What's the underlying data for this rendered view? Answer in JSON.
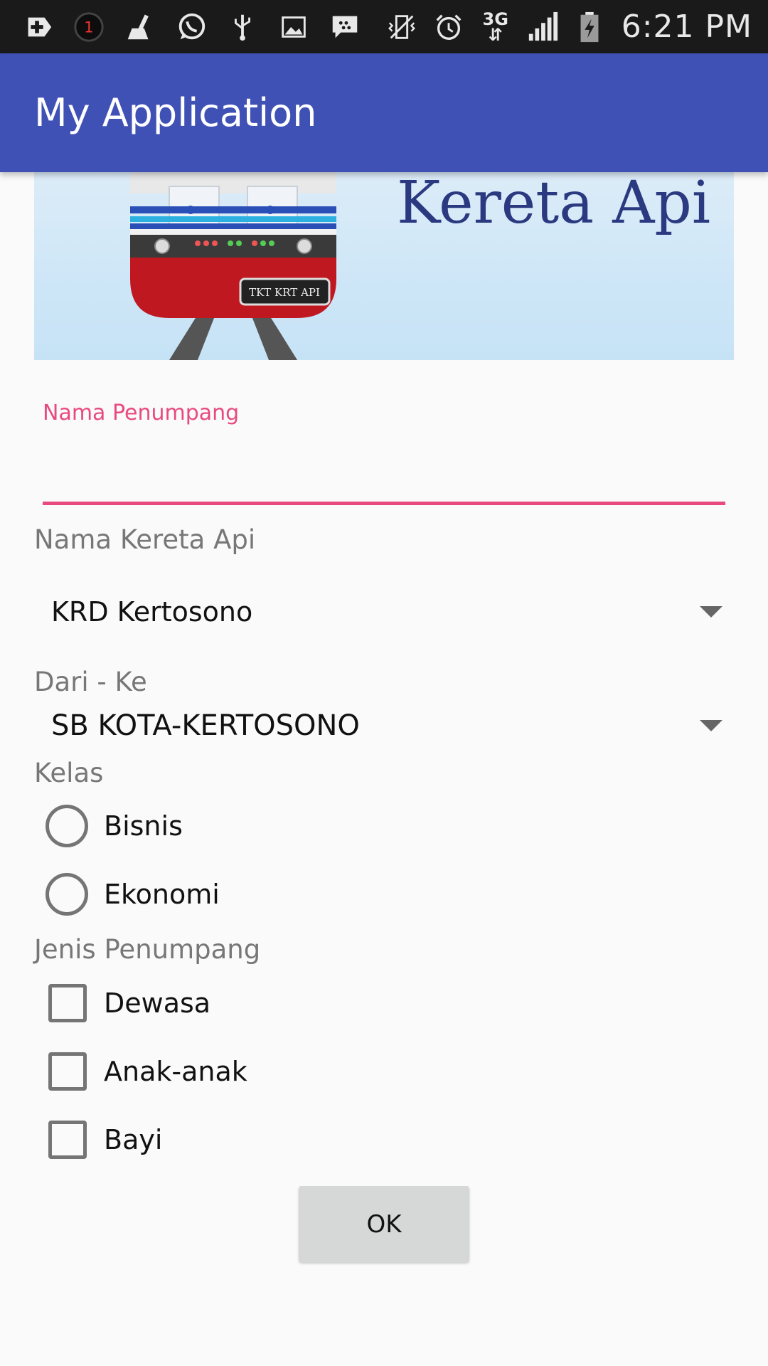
{
  "status_bar": {
    "time": "6:21 PM",
    "notification_count": "1",
    "network_type": "3G",
    "icons": [
      "add-icon",
      "notification-badge-icon",
      "cleaner-icon",
      "whatsapp-icon",
      "usb-icon",
      "image-icon",
      "bbm-icon",
      "vibrate-icon",
      "alarm-icon",
      "network-3g-icon",
      "signal-icon",
      "battery-charging-icon"
    ]
  },
  "app_bar": {
    "title": "My Application"
  },
  "banner": {
    "text": "Kereta Api",
    "badge": "TKT KRT API"
  },
  "form": {
    "passenger_name": {
      "label": "Nama Penumpang",
      "value": ""
    },
    "train_name": {
      "label": "Nama Kereta Api",
      "selected": "KRD Kertosono"
    },
    "route": {
      "label": "Dari - Ke",
      "selected": "SB KOTA-KERTOSONO"
    },
    "class": {
      "label": "Kelas",
      "options": [
        "Bisnis",
        "Ekonomi"
      ]
    },
    "passenger_type": {
      "label": "Jenis Penumpang",
      "options": [
        "Dewasa",
        "Anak-anak",
        "Bayi"
      ]
    },
    "submit_label": "OK"
  },
  "colors": {
    "status_bar": "#1a1a1a",
    "app_bar": "#3f51b5",
    "accent": "#e84a7f",
    "background": "#fafafa",
    "button": "#d6d7d7"
  }
}
